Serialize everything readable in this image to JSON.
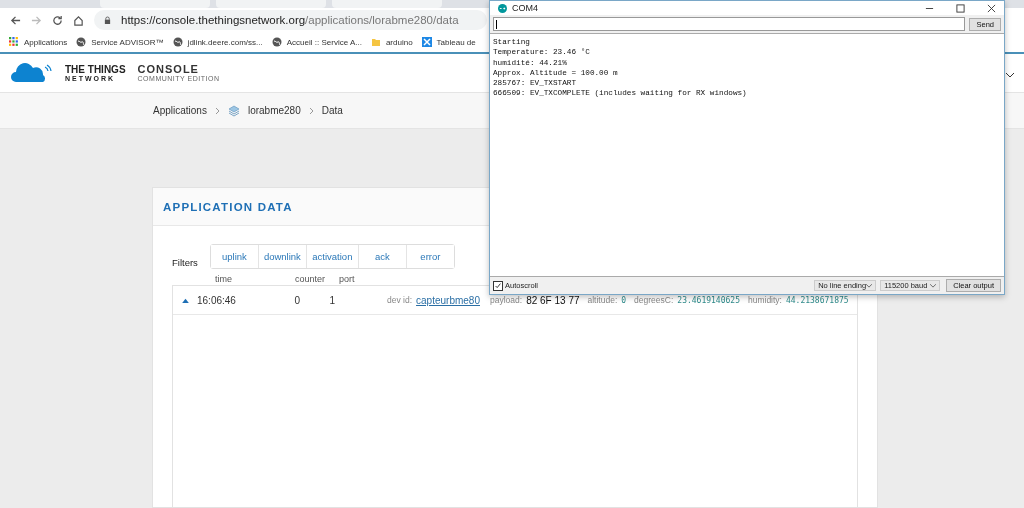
{
  "browser": {
    "url_host": "https://console.thethingsnetwork.org",
    "url_path": "/applications/lorabme280/data",
    "bookmarks": [
      {
        "label": "Applications",
        "kind": "apps"
      },
      {
        "label": "Service ADVISOR™",
        "kind": "globe"
      },
      {
        "label": "jdlink.deere.com/ss...",
        "kind": "globe"
      },
      {
        "label": "Accueil :: Service A...",
        "kind": "globe"
      },
      {
        "label": "arduino",
        "kind": "folder"
      },
      {
        "label": "Tableau de",
        "kind": "board"
      }
    ]
  },
  "header": {
    "brand_top": "THE THINGS",
    "brand_bottom": "NETWORK",
    "console": "CONSOLE",
    "edition": "COMMUNITY EDITION"
  },
  "breadcrumb": [
    "Applications",
    "lorabme280",
    "Data"
  ],
  "card": {
    "title": "APPLICATION DATA",
    "filters_label": "Filters",
    "filters": [
      {
        "label": "uplink",
        "selected": false
      },
      {
        "label": "downlink",
        "selected": false
      },
      {
        "label": "activation",
        "selected": false
      },
      {
        "label": "ack",
        "selected": false
      },
      {
        "label": "error",
        "selected": false
      }
    ],
    "columns": [
      "time",
      "counter",
      "port"
    ],
    "rows": [
      {
        "expanded": true,
        "time": "16:06:46",
        "counter": "0",
        "port": "1",
        "dev_id_label": "dev id:",
        "dev_id": "capteurbme80",
        "payload_label": "payload:",
        "payload": "82 6F 13 77",
        "fields": [
          {
            "label": "altitude:",
            "value": "0"
          },
          {
            "label": "degreesC:",
            "value": "23.4619140625"
          },
          {
            "label": "humidity:",
            "value": "44.2138671875"
          }
        ]
      }
    ]
  },
  "serial_monitor": {
    "title": "COM4",
    "send": "Send",
    "lines": [
      "Starting",
      "Temperature: 23.46 °C",
      "humidité: 44.21%",
      "Approx. Altitude = 100.00 m",
      "285767: EV_TXSTART",
      "666509: EV_TXCOMPLETE (includes waiting for RX windows)"
    ],
    "autoscroll": {
      "label": "Autoscroll",
      "checked": true
    },
    "line_ending": "No line ending",
    "baud": "115200 baud",
    "clear": "Clear output"
  }
}
